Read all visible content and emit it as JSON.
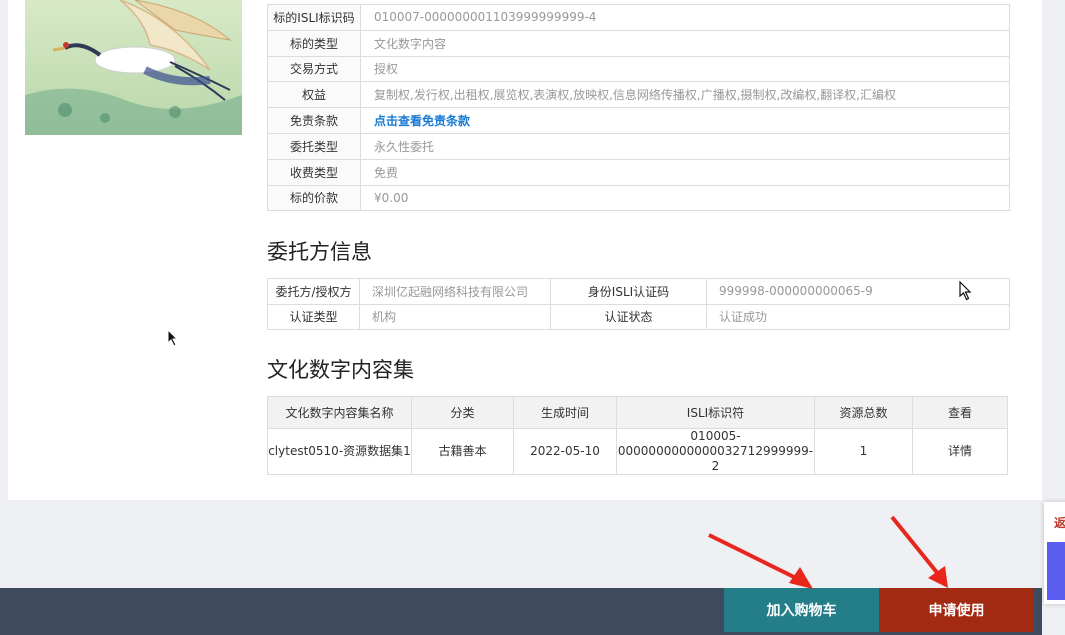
{
  "asset_attributes": [
    {
      "label": "标的ISLI标识码",
      "value": "010007-000000001103999999999-4"
    },
    {
      "label": "标的类型",
      "value": "文化数字内容"
    },
    {
      "label": "交易方式",
      "value": "授权"
    },
    {
      "label": "权益",
      "value": "复制权,发行权,出租权,展览权,表演权,放映权,信息网络传播权,广播权,摄制权,改编权,翻译权,汇编权"
    },
    {
      "label": "免责条款",
      "value": "点击查看免责条款"
    },
    {
      "label": "委托类型",
      "value": "永久性委托"
    },
    {
      "label": "收费类型",
      "value": "免费"
    },
    {
      "label": "标的价款",
      "value": "¥0.00"
    }
  ],
  "owner_section": {
    "title": "委托方信息",
    "rows": [
      {
        "label1": "委托方/授权方",
        "value1": "深圳亿起融网络科技有限公司",
        "label2": "身份ISLI认证码",
        "value2": "999998-000000000065-9"
      },
      {
        "label1": "认证类型",
        "value1": "机构",
        "label2": "认证状态",
        "value2": "认证成功"
      }
    ]
  },
  "content_set": {
    "title": "文化数字内容集",
    "headers": [
      "文化数字内容集名称",
      "分类",
      "生成时间",
      "ISLI标识符",
      "资源总数",
      "查看"
    ],
    "rows": [
      {
        "name": "clytest0510-资源数据集1",
        "category": "古籍善本",
        "date": "2022-05-10",
        "isli_line1": "010005-",
        "isli_line2": "0000000000000032712999999-2",
        "count": "1",
        "view": "详情"
      }
    ]
  },
  "actions": {
    "cart": "加入购物车",
    "apply": "申请使用"
  },
  "side_float": {
    "text": "返"
  },
  "colors": {
    "cart": "#237e87",
    "apply": "#a22a12",
    "bar": "#3e4a5e",
    "link": "#1a7bd6",
    "annotation": "#e8261c"
  },
  "icons": {
    "cursor": "mouse-pointer-icon",
    "thumbnail": "crane-artwork-image"
  }
}
